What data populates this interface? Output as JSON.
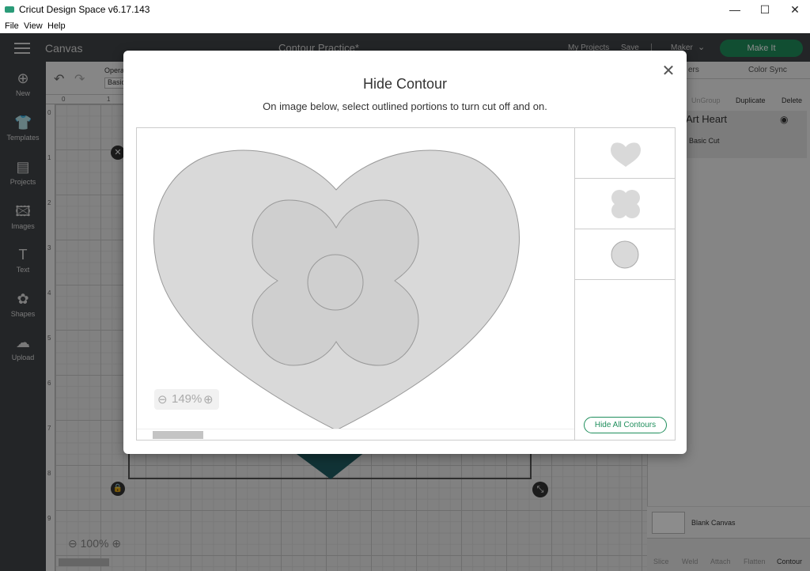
{
  "window": {
    "title": "Cricut Design Space  v6.17.143",
    "minimize": "—",
    "maximize": "☐",
    "close": "✕"
  },
  "menu": [
    "File",
    "View",
    "Help"
  ],
  "topbar": {
    "section": "Canvas",
    "project_title": "Contour Practice*",
    "my_projects": "My Projects",
    "save": "Save",
    "separator": "|",
    "machine": "Maker",
    "make_it": "Make It"
  },
  "leftbar": [
    {
      "label": "New",
      "icon": "plus-circle-icon"
    },
    {
      "label": "Templates",
      "icon": "shirt-icon"
    },
    {
      "label": "Projects",
      "icon": "notebook-icon"
    },
    {
      "label": "Images",
      "icon": "image-icon"
    },
    {
      "label": "Text",
      "icon": "text-t-icon"
    },
    {
      "label": "Shapes",
      "icon": "shapes-icon"
    },
    {
      "label": "Upload",
      "icon": "cloud-upload-icon"
    }
  ],
  "toolbar": {
    "operation_label": "Operat",
    "operation_value": "Basic"
  },
  "ruler": {
    "top": [
      "0",
      "1"
    ],
    "left": [
      "0",
      "1",
      "2",
      "3",
      "4",
      "5",
      "6",
      "7",
      "8",
      "9"
    ]
  },
  "canvas": {
    "zoom": "100%"
  },
  "rightpanel": {
    "tabs": [
      "ers",
      "Color Sync"
    ],
    "actions": [
      "UnGroup",
      "Duplicate",
      "Delete"
    ],
    "layer_name": "Art Heart",
    "layer_type": "Basic Cut",
    "blank_canvas": "Blank Canvas",
    "bottom_tools": [
      "Slice",
      "Weld",
      "Attach",
      "Flatten",
      "Contour"
    ]
  },
  "dialog": {
    "title": "Hide Contour",
    "subtitle": "On image below, select outlined portions to turn cut off and on.",
    "zoom": "149%",
    "hide_all": "Hide All Contours",
    "colors": {
      "fill": "#d9d9d9",
      "inner": "#cfcfcf",
      "accent": "#1f8e5c"
    }
  }
}
